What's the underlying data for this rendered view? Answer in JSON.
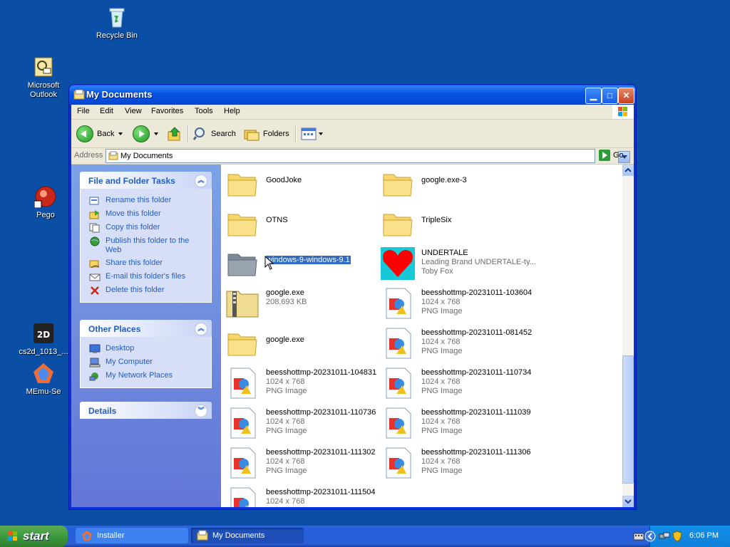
{
  "desktop": {
    "icons": [
      {
        "label": "Recycle Bin"
      },
      {
        "label": "Microsoft Outlook"
      },
      {
        "label": "Pego"
      },
      {
        "label": "cs2d_1013_..."
      },
      {
        "label": "MEmu-Se"
      }
    ]
  },
  "window": {
    "title": "My Documents",
    "menu": [
      "File",
      "Edit",
      "View",
      "Favorites",
      "Tools",
      "Help"
    ],
    "toolbar": {
      "back": "Back",
      "search": "Search",
      "folders": "Folders"
    },
    "address": {
      "label": "Address",
      "value": "My Documents",
      "go": "Go"
    }
  },
  "tasks": {
    "file_folder": {
      "title": "File and Folder Tasks",
      "items": [
        "Rename this folder",
        "Move this folder",
        "Copy this folder",
        "Publish this folder to the Web",
        "Share this folder",
        "E-mail this folder's files",
        "Delete this folder"
      ]
    },
    "other_places": {
      "title": "Other Places",
      "items": [
        "Desktop",
        "My Computer",
        "My Network Places"
      ]
    },
    "details": {
      "title": "Details"
    }
  },
  "files": [
    {
      "name": "GoodJoke",
      "type": "folder"
    },
    {
      "name": "google.exe-3",
      "type": "folder"
    },
    {
      "name": "OTNS",
      "type": "folder"
    },
    {
      "name": "TripleSix",
      "type": "folder"
    },
    {
      "name": "windows-9-windows-9.1",
      "type": "folder-gray",
      "selected": true
    },
    {
      "name": "UNDERTALE",
      "type": "heart",
      "sub1": "Leading Brand UNDERTALE-ty...",
      "sub2": "Toby Fox"
    },
    {
      "name": "google.exe",
      "type": "zip",
      "sub1": "208,693 KB"
    },
    {
      "name": "beesshottmp-20231011-103604",
      "type": "png",
      "sub1": "1024 x 768",
      "sub2": "PNG Image"
    },
    {
      "name": "google.exe",
      "type": "folder"
    },
    {
      "name": "beesshottmp-20231011-081452",
      "type": "png",
      "sub1": "1024 x 768",
      "sub2": "PNG Image"
    },
    {
      "name": "beesshottmp-20231011-104831",
      "type": "png",
      "sub1": "1024 x 768",
      "sub2": "PNG Image"
    },
    {
      "name": "beesshottmp-20231011-110734",
      "type": "png",
      "sub1": "1024 x 768",
      "sub2": "PNG Image"
    },
    {
      "name": "beesshottmp-20231011-110736",
      "type": "png",
      "sub1": "1024 x 768",
      "sub2": "PNG Image"
    },
    {
      "name": "beesshottmp-20231011-111039",
      "type": "png",
      "sub1": "1024 x 768",
      "sub2": "PNG Image"
    },
    {
      "name": "beesshottmp-20231011-111302",
      "type": "png",
      "sub1": "1024 x 768",
      "sub2": "PNG Image"
    },
    {
      "name": "beesshottmp-20231011-111306",
      "type": "png",
      "sub1": "1024 x 768",
      "sub2": "PNG Image"
    },
    {
      "name": "beesshottmp-20231011-111504",
      "type": "png",
      "sub1": "1024 x 768"
    }
  ],
  "taskbar": {
    "start": "start",
    "items": [
      "Installer",
      "My Documents"
    ],
    "clock": "6:06 PM"
  },
  "colors": {
    "desktop": "#0a4ea6",
    "link": "#215dc6",
    "selection": "#316ac5"
  }
}
